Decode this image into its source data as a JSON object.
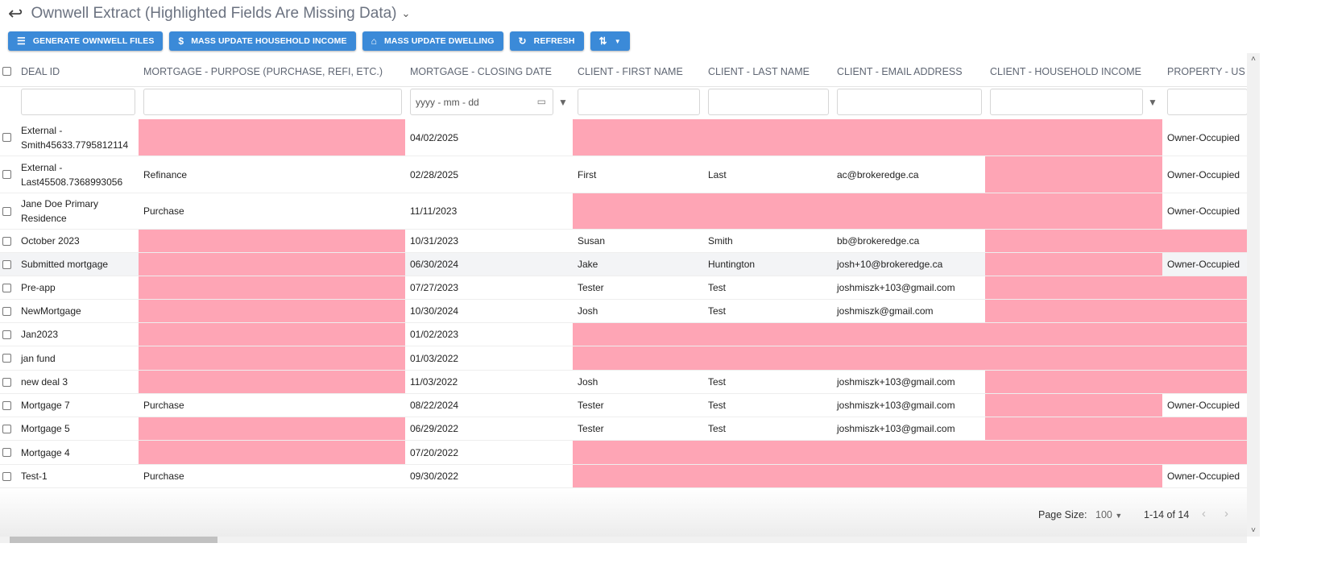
{
  "header": {
    "title": "Ownwell Extract (Highlighted Fields Are Missing Data)"
  },
  "toolbar": {
    "generate": "GENERATE OWNWELL FILES",
    "income": "MASS UPDATE HOUSEHOLD INCOME",
    "dwelling": "MASS UPDATE DWELLING",
    "refresh": "REFRESH"
  },
  "columns": [
    "DEAL ID",
    "MORTGAGE - PURPOSE (PURCHASE, REFI, ETC.)",
    "MORTGAGE - CLOSING DATE",
    "CLIENT - FIRST NAME",
    "CLIENT - LAST NAME",
    "CLIENT - EMAIL ADDRESS",
    "CLIENT - HOUSEHOLD INCOME",
    "PROPERTY - US"
  ],
  "filters": {
    "date_placeholder": "yyyy - mm - dd"
  },
  "highlight_color": "#fea5b5",
  "rows": [
    {
      "cells": [
        "External - Smith45633.7795812114",
        "",
        "04/02/2025",
        "",
        "",
        "",
        "",
        "Owner-Occupied"
      ],
      "missing": [
        1,
        3,
        4,
        5,
        6
      ]
    },
    {
      "cells": [
        "External - Last45508.7368993056",
        "Refinance",
        "02/28/2025",
        "First",
        "Last",
        "ac@brokeredge.ca",
        "",
        "Owner-Occupied"
      ],
      "missing": [
        6
      ]
    },
    {
      "cells": [
        "Jane Doe Primary Residence",
        "Purchase",
        "11/11/2023",
        "",
        "",
        "",
        "",
        "Owner-Occupied"
      ],
      "missing": [
        3,
        4,
        5,
        6
      ]
    },
    {
      "cells": [
        "October 2023",
        "",
        "10/31/2023",
        "Susan",
        "Smith",
        "bb@brokeredge.ca",
        "",
        ""
      ],
      "missing": [
        1,
        6,
        7
      ]
    },
    {
      "cells": [
        "Submitted mortgage",
        "",
        "06/30/2024",
        "Jake",
        "Huntington",
        "josh+10@brokeredge.ca",
        "",
        "Owner-Occupied"
      ],
      "missing": [
        1,
        6
      ]
    },
    {
      "cells": [
        "Pre-app",
        "",
        "07/27/2023",
        "Tester",
        "Test",
        "joshmiszk+103@gmail.com",
        "",
        ""
      ],
      "missing": [
        1,
        6,
        7
      ]
    },
    {
      "cells": [
        "NewMortgage",
        "",
        "10/30/2024",
        "Josh",
        "Test",
        "joshmiszk@gmail.com",
        "",
        ""
      ],
      "missing": [
        1,
        6,
        7
      ]
    },
    {
      "cells": [
        "Jan2023",
        "",
        "01/02/2023",
        "",
        "",
        "",
        "",
        ""
      ],
      "missing": [
        1,
        3,
        4,
        5,
        6,
        7
      ]
    },
    {
      "cells": [
        "jan fund",
        "",
        "01/03/2022",
        "",
        "",
        "",
        "",
        ""
      ],
      "missing": [
        1,
        3,
        4,
        5,
        6,
        7
      ]
    },
    {
      "cells": [
        "new deal 3",
        "",
        "11/03/2022",
        "Josh",
        "Test",
        "joshmiszk+103@gmail.com",
        "",
        ""
      ],
      "missing": [
        1,
        6,
        7
      ]
    },
    {
      "cells": [
        "Mortgage 7",
        "Purchase",
        "08/22/2024",
        "Tester",
        "Test",
        "joshmiszk+103@gmail.com",
        "",
        "Owner-Occupied"
      ],
      "missing": [
        6
      ]
    },
    {
      "cells": [
        "Mortgage 5",
        "",
        "06/29/2022",
        "Tester",
        "Test",
        "joshmiszk+103@gmail.com",
        "",
        ""
      ],
      "missing": [
        1,
        6,
        7
      ]
    },
    {
      "cells": [
        "Mortgage 4",
        "",
        "07/20/2022",
        "",
        "",
        "",
        "",
        ""
      ],
      "missing": [
        1,
        3,
        4,
        5,
        6,
        7
      ]
    },
    {
      "cells": [
        "Test-1",
        "Purchase",
        "09/30/2022",
        "",
        "",
        "",
        "",
        "Owner-Occupied"
      ],
      "missing": [
        3,
        4,
        5,
        6
      ]
    }
  ],
  "pager": {
    "page_size_label": "Page Size:",
    "page_size": "100",
    "range": "1-14 of 14"
  }
}
